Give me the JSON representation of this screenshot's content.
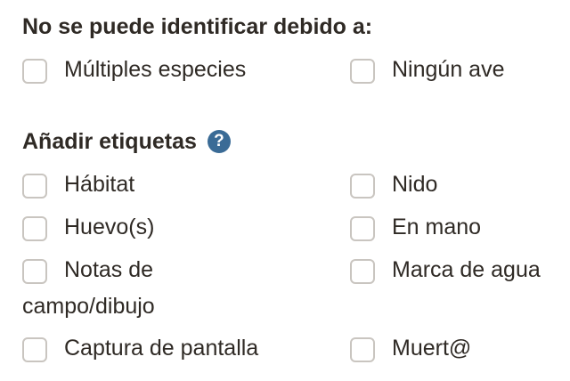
{
  "section_unidentifiable": {
    "title": "No se puede identificar debido a:",
    "options": [
      {
        "label": "Múltiples especies",
        "checked": false
      },
      {
        "label": "Ningún ave",
        "checked": false
      }
    ]
  },
  "section_tags": {
    "title": "Añadir etiquetas",
    "help_icon": "question-circle-icon",
    "help_glyph": "?",
    "options": [
      {
        "label": "Hábitat",
        "checked": false
      },
      {
        "label": "Nido",
        "checked": false
      },
      {
        "label": "Huevo(s)",
        "checked": false
      },
      {
        "label": "En mano",
        "checked": false
      },
      {
        "label_line1": "Notas de",
        "label_line2": "campo/dibujo",
        "checked": false
      },
      {
        "label": "Marca de agua",
        "checked": false
      },
      {
        "label": "Captura de pantalla",
        "checked": false
      },
      {
        "label": "Muert@",
        "checked": false
      }
    ]
  },
  "colors": {
    "text": "#2f2a25",
    "checkbox_border": "#c9c5c0",
    "help_icon_bg": "#3a6b96"
  }
}
